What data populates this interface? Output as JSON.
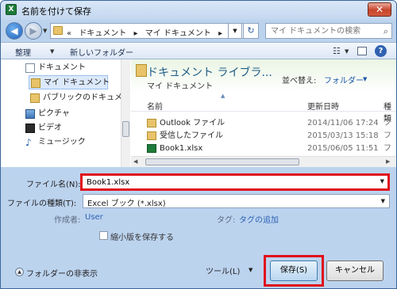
{
  "window": {
    "title": "名前を付けて保存",
    "close_glyph": "✕"
  },
  "nav": {
    "back_glyph": "◀",
    "forward_glyph": "▶",
    "breadcrumb": [
      "«",
      "ドキュメント",
      "▸",
      "マイ ドキュメント",
      "▸"
    ],
    "refresh_glyph": "↻",
    "search_placeholder": "マイ ドキュメントの検索",
    "search_icon": "search-icon"
  },
  "toolbar": {
    "organize_label": "整理",
    "new_folder_label": "新しいフォルダー",
    "view_glyph": "☷",
    "help_glyph": "?"
  },
  "navpane": {
    "items": [
      {
        "label": "ドキュメント",
        "icon": "documents-icon"
      },
      {
        "label": "マイ ドキュメント",
        "icon": "folder-icon"
      },
      {
        "label": "パブリックのドキュメン",
        "icon": "folder-icon"
      },
      {
        "label": "ピクチャ",
        "icon": "pictures-icon"
      },
      {
        "label": "ビデオ",
        "icon": "video-icon"
      },
      {
        "label": "ミュージック",
        "icon": "music-icon"
      }
    ],
    "music_glyph": "♪"
  },
  "library": {
    "title": "ドキュメント ライブラ...",
    "subtitle": "マイ ドキュメント",
    "arrange_label": "並べ替え:",
    "arrange_value": "フォルダー"
  },
  "columns": {
    "name": "名前",
    "date": "更新日時",
    "type": "種類"
  },
  "files": [
    {
      "name": "Outlook ファイル",
      "date": "2014/11/06 17:24",
      "type": "フ",
      "icon": "folder-icon"
    },
    {
      "name": "受信したファイル",
      "date": "2015/03/13 15:18",
      "type": "フ",
      "icon": "folder-icon"
    },
    {
      "name": "Book1.xlsx",
      "date": "2015/06/05 11:51",
      "type": "フ",
      "icon": "excel-file-icon"
    }
  ],
  "form": {
    "filename_label": "ファイル名(N):",
    "filename_value": "Book1.xlsx",
    "filetype_label": "ファイルの種類(T):",
    "filetype_value": "Excel ブック (*.xlsx)",
    "author_label": "作成者:",
    "author_value": "User",
    "tags_label": "タグ:",
    "tags_value": "タグの追加",
    "thumbnail_label": "縮小版を保存する",
    "hide_folders_label": "フォルダーの非表示",
    "tools_label": "ツール(L)",
    "save_label": "保存(S)",
    "cancel_label": "キャンセル"
  },
  "colors": {
    "highlight_outline": "#e0101a",
    "link": "#2c63b4",
    "library_title": "#1f5c86"
  }
}
